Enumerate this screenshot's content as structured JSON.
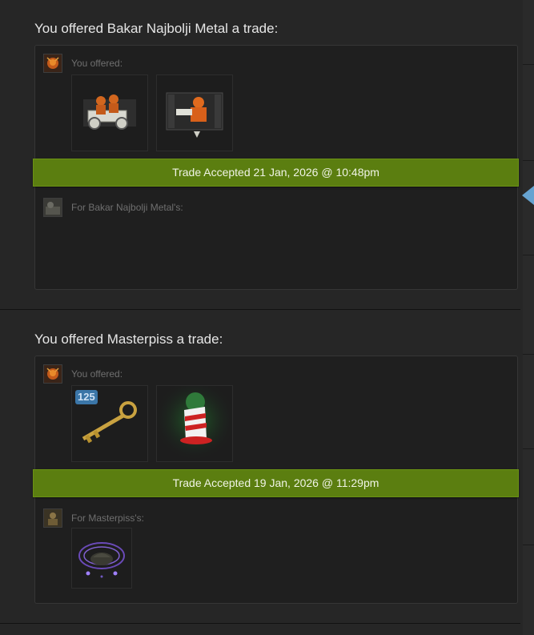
{
  "offers": [
    {
      "title": "You offered Bakar Najbolji Metal a trade:",
      "you_offered_label": "You offered:",
      "their_label": "For Bakar Najbolji Metal's:",
      "status": "Trade Accepted 21 Jan, 2026 @ 10:48pm",
      "your_items": [
        {
          "name": "orange-mercenaries-with-vehicle-item",
          "icon": "vehicle-crew-icon"
        },
        {
          "name": "orange-mercenary-taunt-item",
          "icon": "taunt-icon"
        }
      ],
      "their_items": []
    },
    {
      "title": "You offered Masterpiss a trade:",
      "you_offered_label": "You offered:",
      "their_label": "For Masterpiss's:",
      "status": "Trade Accepted 19 Jan, 2026 @ 11:29pm",
      "your_items": [
        {
          "name": "gold-key-item",
          "icon": "key-icon",
          "badge": "125"
        },
        {
          "name": "striped-hat-item",
          "icon": "hat-icon"
        }
      ],
      "their_items": [
        {
          "name": "purple-unusual-item",
          "icon": "unusual-effect-icon"
        }
      ]
    }
  ],
  "colors": {
    "accepted_bar": "#5b7e10",
    "badge": "#3b76a8",
    "accent_arrow": "#66a3d1"
  }
}
